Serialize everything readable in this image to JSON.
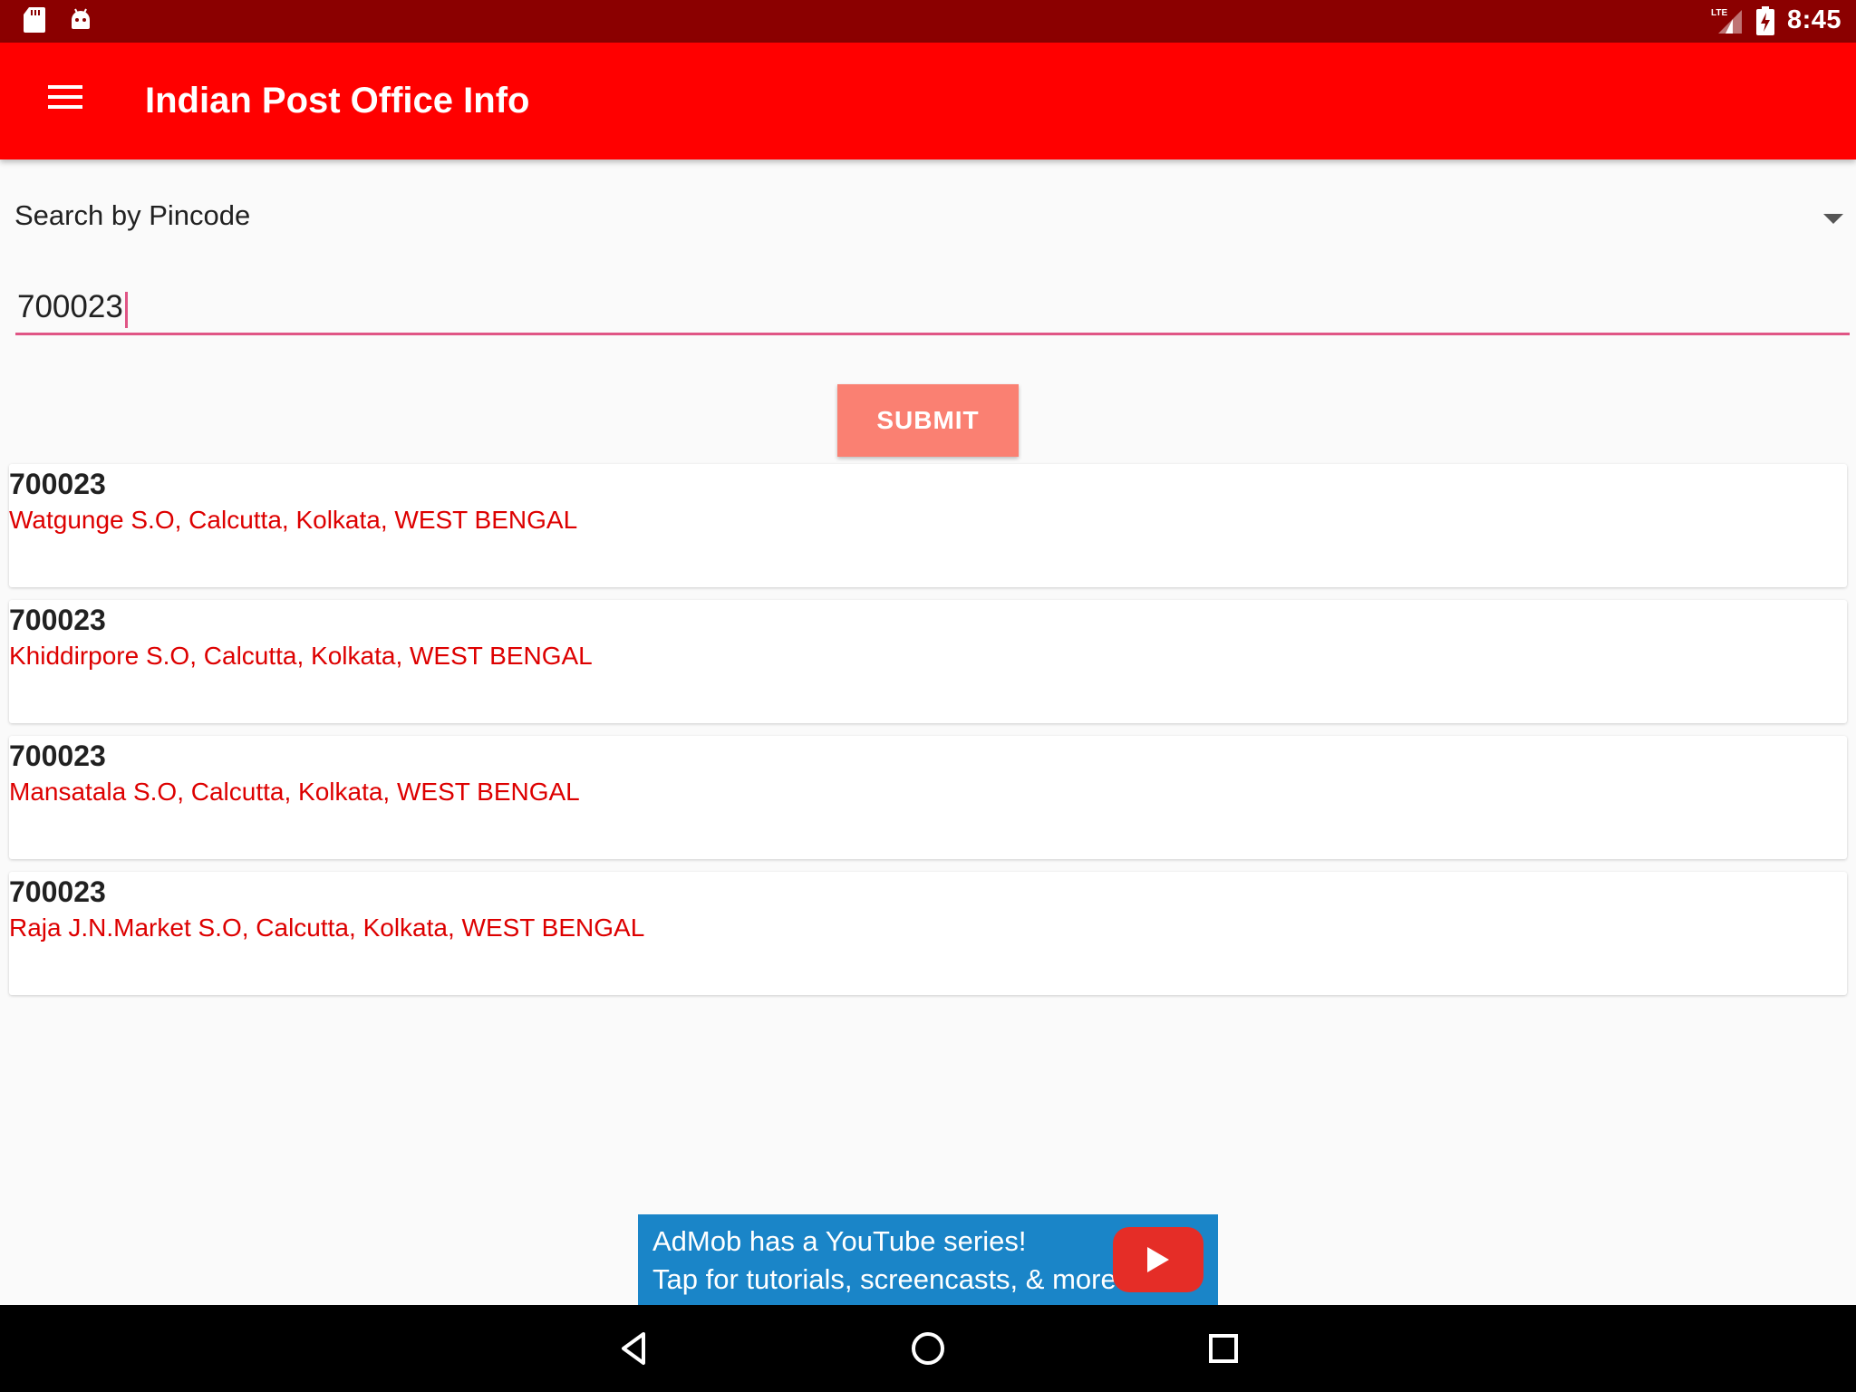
{
  "status_bar": {
    "time": "8:45",
    "network": "LTE"
  },
  "app_bar": {
    "title": "Indian Post Office Info"
  },
  "search": {
    "mode_label": "Search by Pincode",
    "pincode_value": "700023",
    "submit_label": "SUBMIT"
  },
  "results": [
    {
      "pincode": "700023",
      "address": "Watgunge S.O, Calcutta, Kolkata, WEST BENGAL"
    },
    {
      "pincode": "700023",
      "address": "Khiddirpore S.O, Calcutta, Kolkata, WEST BENGAL"
    },
    {
      "pincode": "700023",
      "address": "Mansatala S.O, Calcutta, Kolkata, WEST BENGAL"
    },
    {
      "pincode": "700023",
      "address": "Raja J.N.Market S.O, Calcutta, Kolkata, WEST BENGAL"
    }
  ],
  "ad": {
    "line1": "AdMob has a YouTube series!",
    "line2": "Tap for tutorials, screencasts, & more."
  },
  "colors": {
    "status_bar": "#8b0000",
    "app_bar": "#ff0000",
    "accent": "#e05585",
    "submit": "#fa8072",
    "result_address": "#dd0000",
    "ad_background": "#1a85c8"
  }
}
